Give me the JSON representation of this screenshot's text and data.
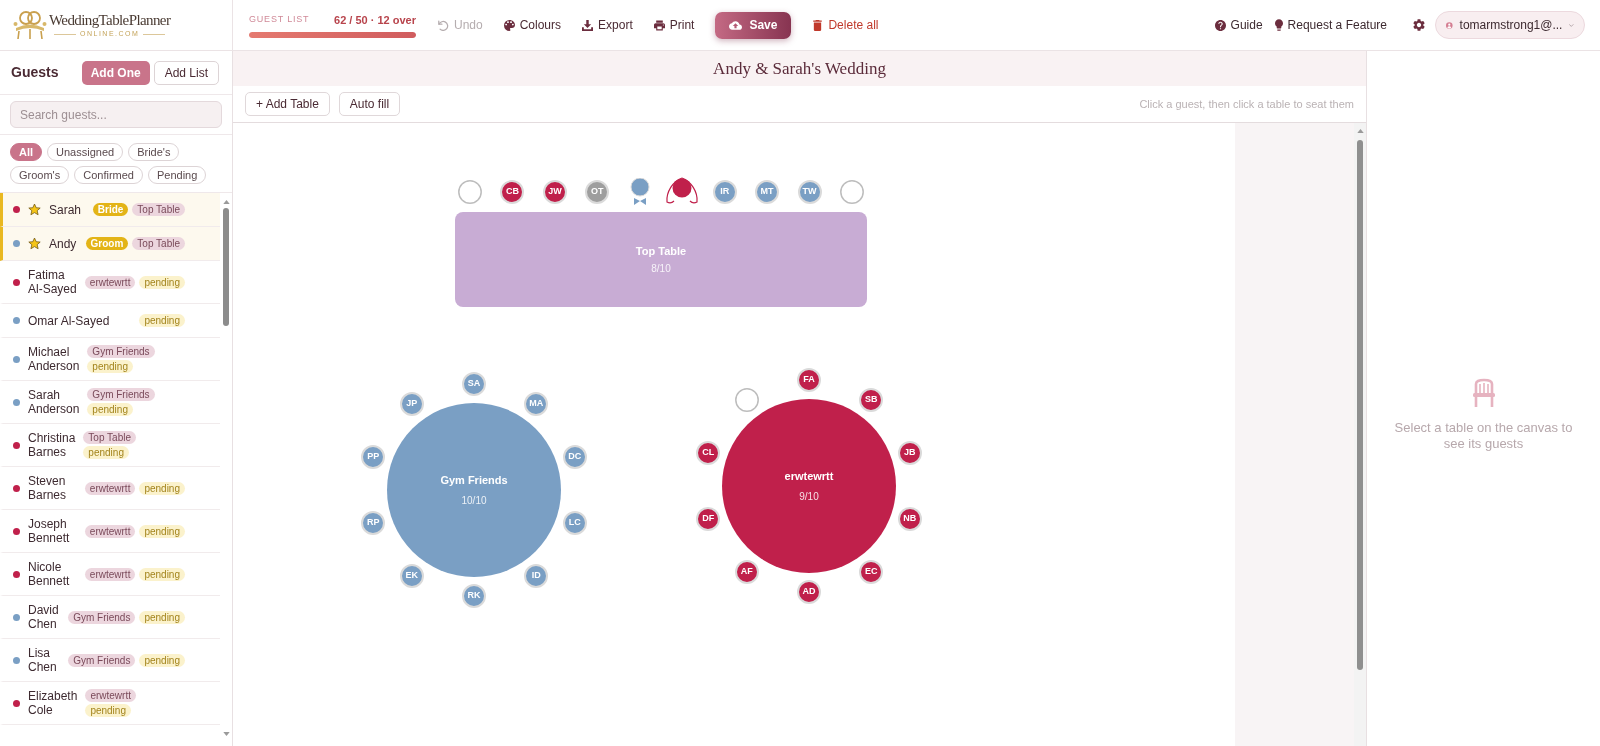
{
  "header": {
    "logo": {
      "title": "WeddingTablePlanner",
      "subtitle": "ONLINE.COM"
    },
    "guest_list": {
      "label": "GUEST LIST",
      "reading": "62 / 50 · 12 over",
      "level": 1
    },
    "toolbar": [
      {
        "label": "Undo",
        "kind": "undo",
        "disabled": true
      },
      {
        "label": "Colours",
        "kind": "colours",
        "disabled": false
      },
      {
        "label": "Export",
        "kind": "export",
        "disabled": false
      },
      {
        "label": "Print",
        "kind": "print",
        "disabled": false
      },
      {
        "label": "Save",
        "kind": "save",
        "disabled": false
      },
      {
        "label": "Delete all",
        "kind": "delete",
        "disabled": false
      }
    ],
    "links": [
      {
        "label": "Guide",
        "kind": "guide"
      },
      {
        "label": "Request a Feature",
        "kind": "feature"
      }
    ],
    "account": {
      "email": "tomarmstrong1@..."
    }
  },
  "sidebar": {
    "title": "Guests",
    "buttons": [
      {
        "label": "Add One",
        "kind": "primary"
      },
      {
        "label": "Add List",
        "kind": "secondary"
      }
    ],
    "search": {
      "placeholder": "Search guests..."
    },
    "filters": [
      {
        "label": "All",
        "selected": true
      },
      {
        "label": "Unassigned",
        "selected": false
      },
      {
        "label": "Bride's",
        "selected": false
      },
      {
        "label": "Groom's",
        "selected": false
      },
      {
        "label": "Confirmed",
        "selected": false
      },
      {
        "label": "Pending",
        "selected": false
      }
    ],
    "guests": [
      {
        "name": "Sarah",
        "color": "#c0204b",
        "starred": true,
        "role": "Bride",
        "table": "Top Table"
      },
      {
        "name": "Andy",
        "color": "#7a9fc4",
        "starred": true,
        "role": "Groom",
        "table": "Top Table"
      },
      {
        "name": "Fatima Al-Sayed",
        "color": "#c0204b",
        "starred": false,
        "table": "erwtewrtt",
        "status": "pending"
      },
      {
        "name": "Omar Al-Sayed",
        "color": "#7a9fc4",
        "starred": false,
        "status": "pending"
      },
      {
        "name": "Michael Anderson",
        "color": "#7a9fc4",
        "starred": false,
        "table": "Gym Friends",
        "status": "pending"
      },
      {
        "name": "Sarah Anderson",
        "color": "#7a9fc4",
        "starred": false,
        "table": "Gym Friends",
        "status": "pending"
      },
      {
        "name": "Christina Barnes",
        "color": "#c0204b",
        "starred": false,
        "table": "Top Table",
        "status": "pending"
      },
      {
        "name": "Steven Barnes",
        "color": "#c0204b",
        "starred": false,
        "table": "erwtewrtt",
        "status": "pending"
      },
      {
        "name": "Joseph Bennett",
        "color": "#c0204b",
        "starred": false,
        "table": "erwtewrtt",
        "status": "pending"
      },
      {
        "name": "Nicole Bennett",
        "color": "#c0204b",
        "starred": false,
        "table": "erwtewrtt",
        "status": "pending"
      },
      {
        "name": "David Chen",
        "color": "#7a9fc4",
        "starred": false,
        "table": "Gym Friends",
        "status": "pending"
      },
      {
        "name": "Lisa Chen",
        "color": "#7a9fc4",
        "starred": false,
        "table": "Gym Friends",
        "status": "pending"
      },
      {
        "name": "Elizabeth Cole",
        "color": "#c0204b",
        "starred": false,
        "table": "erwtewrtt",
        "status": "pending"
      }
    ]
  },
  "plan": {
    "title": "Andy & Sarah's Wedding",
    "buttons": [
      {
        "label": "+ Add Table"
      },
      {
        "label": "Auto fill"
      }
    ],
    "hint": "Click a guest, then click a table to seat them",
    "tables": [
      {
        "name": "Top Table",
        "count": "8/10",
        "kind": "rectangle",
        "color": "#c8acd4",
        "seats": [
          {
            "kind": "empty"
          },
          {
            "kind": "guest",
            "initials": "CB",
            "color": "#c0204b"
          },
          {
            "kind": "guest",
            "initials": "JW",
            "color": "#c0204b"
          },
          {
            "kind": "guest",
            "initials": "OT",
            "color": "#9e9e9e"
          },
          {
            "kind": "groom",
            "color": "#7a9fc4"
          },
          {
            "kind": "bride",
            "color": "#c0204b"
          },
          {
            "kind": "guest",
            "initials": "IR",
            "color": "#7a9fc4"
          },
          {
            "kind": "guest",
            "initials": "MT",
            "color": "#7a9fc4"
          },
          {
            "kind": "guest",
            "initials": "TW",
            "color": "#7a9fc4"
          },
          {
            "kind": "empty"
          }
        ]
      },
      {
        "name": "Gym Friends",
        "count": "10/10",
        "kind": "round",
        "color": "#7a9fc4",
        "seats": [
          {
            "kind": "guest",
            "initials": "SA",
            "color": "#7a9fc4"
          },
          {
            "kind": "guest",
            "initials": "MA",
            "color": "#7a9fc4"
          },
          {
            "kind": "guest",
            "initials": "DC",
            "color": "#7a9fc4"
          },
          {
            "kind": "guest",
            "initials": "LC",
            "color": "#7a9fc4"
          },
          {
            "kind": "guest",
            "initials": "ID",
            "color": "#7a9fc4"
          },
          {
            "kind": "guest",
            "initials": "RK",
            "color": "#7a9fc4"
          },
          {
            "kind": "guest",
            "initials": "EK",
            "color": "#7a9fc4"
          },
          {
            "kind": "guest",
            "initials": "RP",
            "color": "#7a9fc4"
          },
          {
            "kind": "guest",
            "initials": "PP",
            "color": "#7a9fc4"
          },
          {
            "kind": "guest",
            "initials": "JP",
            "color": "#7a9fc4"
          }
        ]
      },
      {
        "name": "erwtewrtt",
        "count": "9/10",
        "kind": "round",
        "color": "#c0204b",
        "seats": [
          {
            "kind": "guest",
            "initials": "FA",
            "color": "#c0204b"
          },
          {
            "kind": "guest",
            "initials": "SB",
            "color": "#c0204b"
          },
          {
            "kind": "guest",
            "initials": "JB",
            "color": "#c0204b"
          },
          {
            "kind": "guest",
            "initials": "NB",
            "color": "#c0204b"
          },
          {
            "kind": "guest",
            "initials": "EC",
            "color": "#c0204b"
          },
          {
            "kind": "guest",
            "initials": "AD",
            "color": "#c0204b"
          },
          {
            "kind": "guest",
            "initials": "AF",
            "color": "#c0204b"
          },
          {
            "kind": "guest",
            "initials": "DF",
            "color": "#c0204b"
          },
          {
            "kind": "guest",
            "initials": "CL",
            "color": "#c0204b"
          },
          {
            "kind": "empty"
          }
        ]
      }
    ]
  },
  "details": {
    "message": "Select a table on the canvas to see its guests"
  }
}
